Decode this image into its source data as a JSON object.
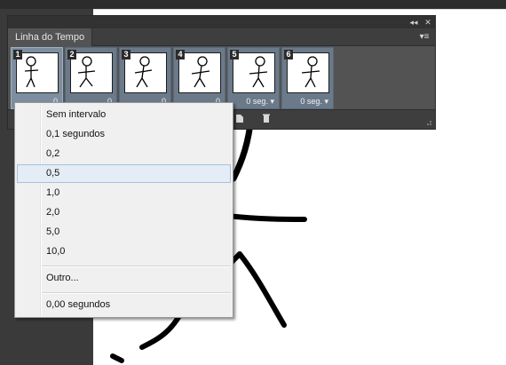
{
  "panel": {
    "tab_label": "Linha do Tempo",
    "collapse_icon": "collapse-arrows-icon",
    "close_icon": "close-icon",
    "menu_icon": "panel-menu-icon"
  },
  "frames": [
    {
      "number": "1",
      "delay": "0",
      "selected": true
    },
    {
      "number": "2",
      "delay": "0",
      "selected": false
    },
    {
      "number": "3",
      "delay": "0",
      "selected": false
    },
    {
      "number": "4",
      "delay": "0",
      "selected": false
    },
    {
      "number": "5",
      "delay": "0 seg.",
      "selected": false
    },
    {
      "number": "6",
      "delay": "0 seg.",
      "selected": false
    }
  ],
  "context_menu": {
    "items": [
      {
        "label": "Sem intervalo"
      },
      {
        "label": "0,1 segundos"
      },
      {
        "label": "0,2"
      },
      {
        "label": "0,5"
      },
      {
        "label": "1,0"
      },
      {
        "label": "2,0"
      },
      {
        "label": "5,0"
      },
      {
        "label": "10,0"
      }
    ],
    "other_label": "Outro...",
    "current_label": "0,00 segundos",
    "hovered_index": 3
  },
  "colors": {
    "panel_bg": "#535353",
    "frame_selected": "#7d8ea0",
    "menu_hover": "#e4ecf5"
  }
}
